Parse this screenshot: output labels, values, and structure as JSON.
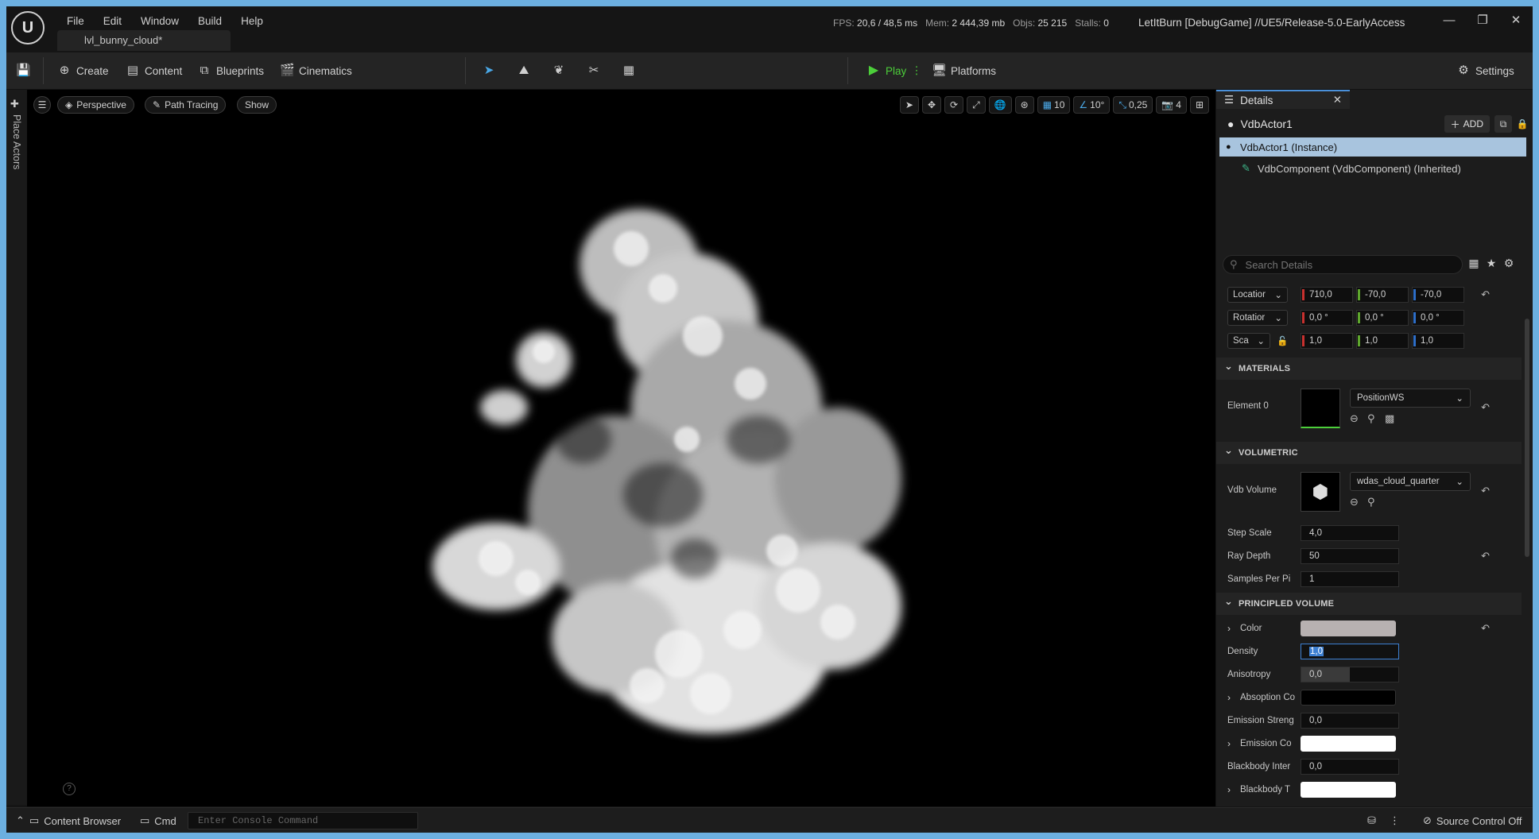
{
  "title_bar": {
    "menu": [
      "File",
      "Edit",
      "Window",
      "Build",
      "Help"
    ],
    "level_tab": "lvl_bunny_cloud*",
    "stats": {
      "fps_label": "FPS:",
      "fps_value": "20,6",
      "ms_value": "/ 48,5 ms",
      "mem_label": "Mem:",
      "mem_value": "2 444,39 mb",
      "objs_label": "Objs:",
      "objs_value": "25 215",
      "stalls_label": "Stalls:",
      "stalls_value": "0"
    },
    "project": "LetItBurn [DebugGame] //UE5/Release-5.0-EarlyAccess"
  },
  "toolbar": {
    "create": "Create",
    "content": "Content",
    "blueprints": "Blueprints",
    "cinematics": "Cinematics",
    "play": "Play",
    "platforms": "Platforms",
    "settings": "Settings"
  },
  "left_rail": {
    "place_actors": "Place Actors"
  },
  "viewport": {
    "perspective": "Perspective",
    "path_tracing": "Path Tracing",
    "show": "Show",
    "grid_snap": "10",
    "rot_snap": "10°",
    "scale_snap": "0,25",
    "camera_speed": "4"
  },
  "details": {
    "tab": "Details",
    "actor_name": "VdbActor1",
    "add_label": "ADD",
    "instance": "VdbActor1  (Instance)",
    "component": "VdbComponent (VdbComponent) (Inherited)",
    "search_placeholder": "Search Details",
    "transform": {
      "location_label": "Locatior",
      "location": [
        "710,0",
        "-70,0",
        "-70,0"
      ],
      "rotation_label": "Rotatior",
      "rotation": [
        "0,0 °",
        "0,0 °",
        "0,0 °"
      ],
      "scale_label": "Sca",
      "scale": [
        "1,0",
        "1,0",
        "1,0"
      ]
    },
    "materials": {
      "header": "MATERIALS",
      "element_label": "Element 0",
      "material": "PositionWS"
    },
    "volumetric": {
      "header": "VOLUMETRIC",
      "vdb_label": "Vdb Volume",
      "vdb_asset": "wdas_cloud_quarter",
      "step_scale_label": "Step Scale",
      "step_scale": "4,0",
      "ray_depth_label": "Ray Depth",
      "ray_depth": "50",
      "samples_label": "Samples Per Pi",
      "samples": "1"
    },
    "principled": {
      "header": "PRINCIPLED VOLUME",
      "color_label": "Color",
      "density_label": "Density",
      "density": "1,0",
      "anisotropy_label": "Anisotropy",
      "anisotropy": "0,0",
      "absorption_label": "Absoption Co",
      "emission_strength_label": "Emission Streng",
      "emission_strength": "0,0",
      "emission_color_label": "Emission Co",
      "blackbody_intensity_label": "Blackbody Inter",
      "blackbody_intensity": "0,0",
      "blackbody_temp_label": "Blackbody T"
    }
  },
  "status_bar": {
    "content_browser": "Content Browser",
    "cmd": "Cmd",
    "console_placeholder": "Enter Console Command",
    "source_control": "Source Control Off"
  },
  "colors": {
    "accent_blue": "#4a90d9",
    "selection": "#a8c4de",
    "play_green": "#4ccf3a",
    "color_swatch": "#b7b1b1",
    "density_focus": "#3d7fd1"
  }
}
